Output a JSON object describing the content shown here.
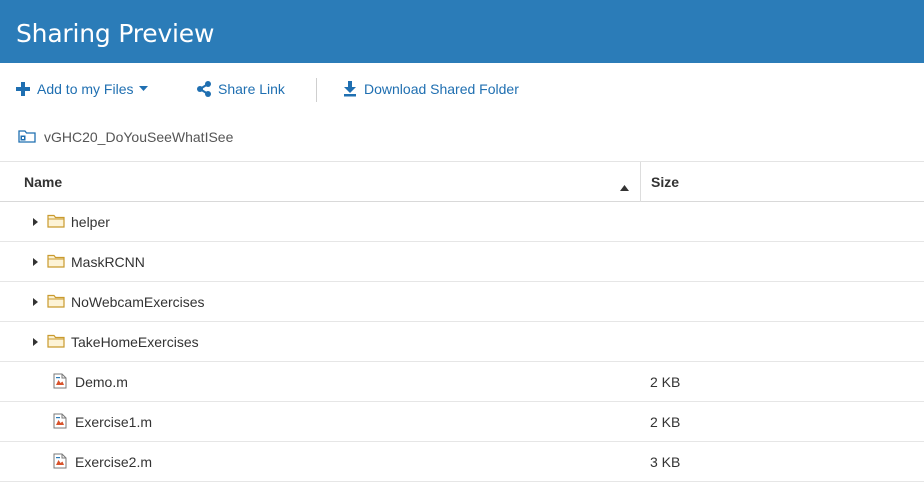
{
  "header": {
    "title": "Sharing Preview"
  },
  "toolbar": {
    "add_label": "Add to my Files",
    "share_label": "Share Link",
    "download_label": "Download Shared Folder"
  },
  "breadcrumb": {
    "folder": "vGHC20_DoYouSeeWhatISee"
  },
  "columns": {
    "name": "Name",
    "size": "Size"
  },
  "rows": [
    {
      "name": "helper",
      "type": "folder",
      "size": ""
    },
    {
      "name": "MaskRCNN",
      "type": "folder",
      "size": ""
    },
    {
      "name": "NoWebcamExercises",
      "type": "folder",
      "size": ""
    },
    {
      "name": "TakeHomeExercises",
      "type": "folder",
      "size": ""
    },
    {
      "name": "Demo.m",
      "type": "file",
      "size": "2 KB"
    },
    {
      "name": "Exercise1.m",
      "type": "file",
      "size": "2 KB"
    },
    {
      "name": "Exercise2.m",
      "type": "file",
      "size": "3 KB"
    }
  ],
  "colors": {
    "header": "#2b7cb8",
    "link": "#1f6fb1",
    "folder": "#e8b84a"
  },
  "icons": {
    "add": "plus-icon",
    "share": "share-icon",
    "download": "download-icon",
    "caret": "caret-down-icon",
    "sort": "sort-ascending-icon",
    "folder": "folder-icon",
    "file": "matlab-file-icon",
    "expand": "expand-arrow-icon"
  }
}
